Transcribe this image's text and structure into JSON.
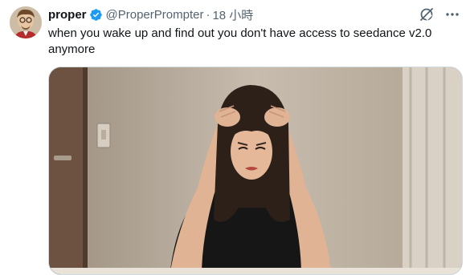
{
  "post": {
    "display_name": "proper",
    "handle": "@ProperPrompter",
    "separator": "·",
    "timestamp": "18 小時",
    "text": "when you wake up and find out you don't have access to seedance v2.0 anymore",
    "verified": true
  },
  "icons": {
    "verified": "verified-badge-icon",
    "grok": "grok-icon",
    "more": "more-options-icon"
  },
  "colors": {
    "verified_blue": "#1d9bf0",
    "secondary_text": "#536471",
    "primary_text": "#0f1419"
  }
}
